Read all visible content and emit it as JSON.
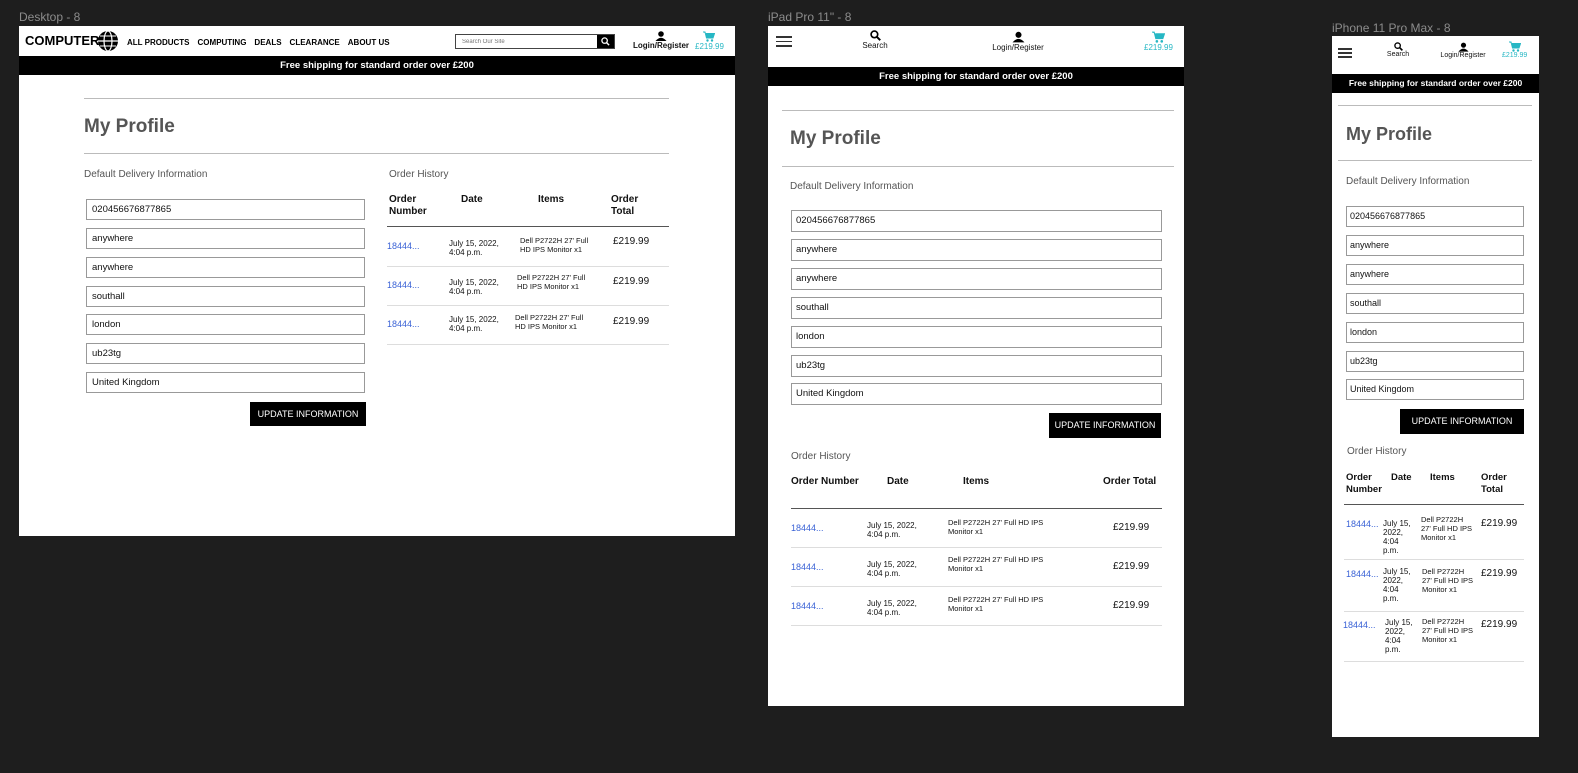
{
  "frames": {
    "desktop_label": "Desktop - 8",
    "ipad_label": "iPad Pro 11\" - 8",
    "iphone_label": "iPhone 11 Pro Max - 8"
  },
  "brand": {
    "logo_text": "COMPUTER",
    "accent_color": "#26b7c4",
    "link_color": "#3b63d6"
  },
  "nav": [
    "ALL PRODUCTS",
    "COMPUTING",
    "DEALS",
    "CLEARANCE",
    "ABOUT US"
  ],
  "search": {
    "placeholder": "Search Our Site",
    "label": "Search"
  },
  "header": {
    "login_label": "Login/Register",
    "cart_total": "£219.99"
  },
  "shipping_banner": "Free shipping for standard order over £200",
  "profile": {
    "title": "My Profile",
    "delivery_label": "Default Delivery Information",
    "fields": [
      "020456676877865",
      "anywhere",
      "anywhere",
      "southall",
      "london",
      "ub23tg",
      "United Kingdom"
    ],
    "update_button": "UPDATE INFORMATION"
  },
  "orders": {
    "label": "Order History",
    "headers": {
      "number": "Order Number",
      "date": "Date",
      "items": "Items",
      "total": "Order Total"
    },
    "rows": [
      {
        "number": "18444...",
        "date": "July 15, 2022, 4:04 p.m.",
        "items": "Dell P2722H 27' Full HD IPS Monitor x1",
        "total": "£219.99"
      },
      {
        "number": "18444...",
        "date": "July 15, 2022, 4:04 p.m.",
        "items": "Dell P2722H 27' Full HD IPS Monitor x1",
        "total": "£219.99"
      },
      {
        "number": "18444...",
        "date": "July 15, 2022, 4:04 p.m.",
        "items": "Dell P2722H 27' Full HD IPS Monitor x1",
        "total": "£219.99"
      }
    ]
  }
}
